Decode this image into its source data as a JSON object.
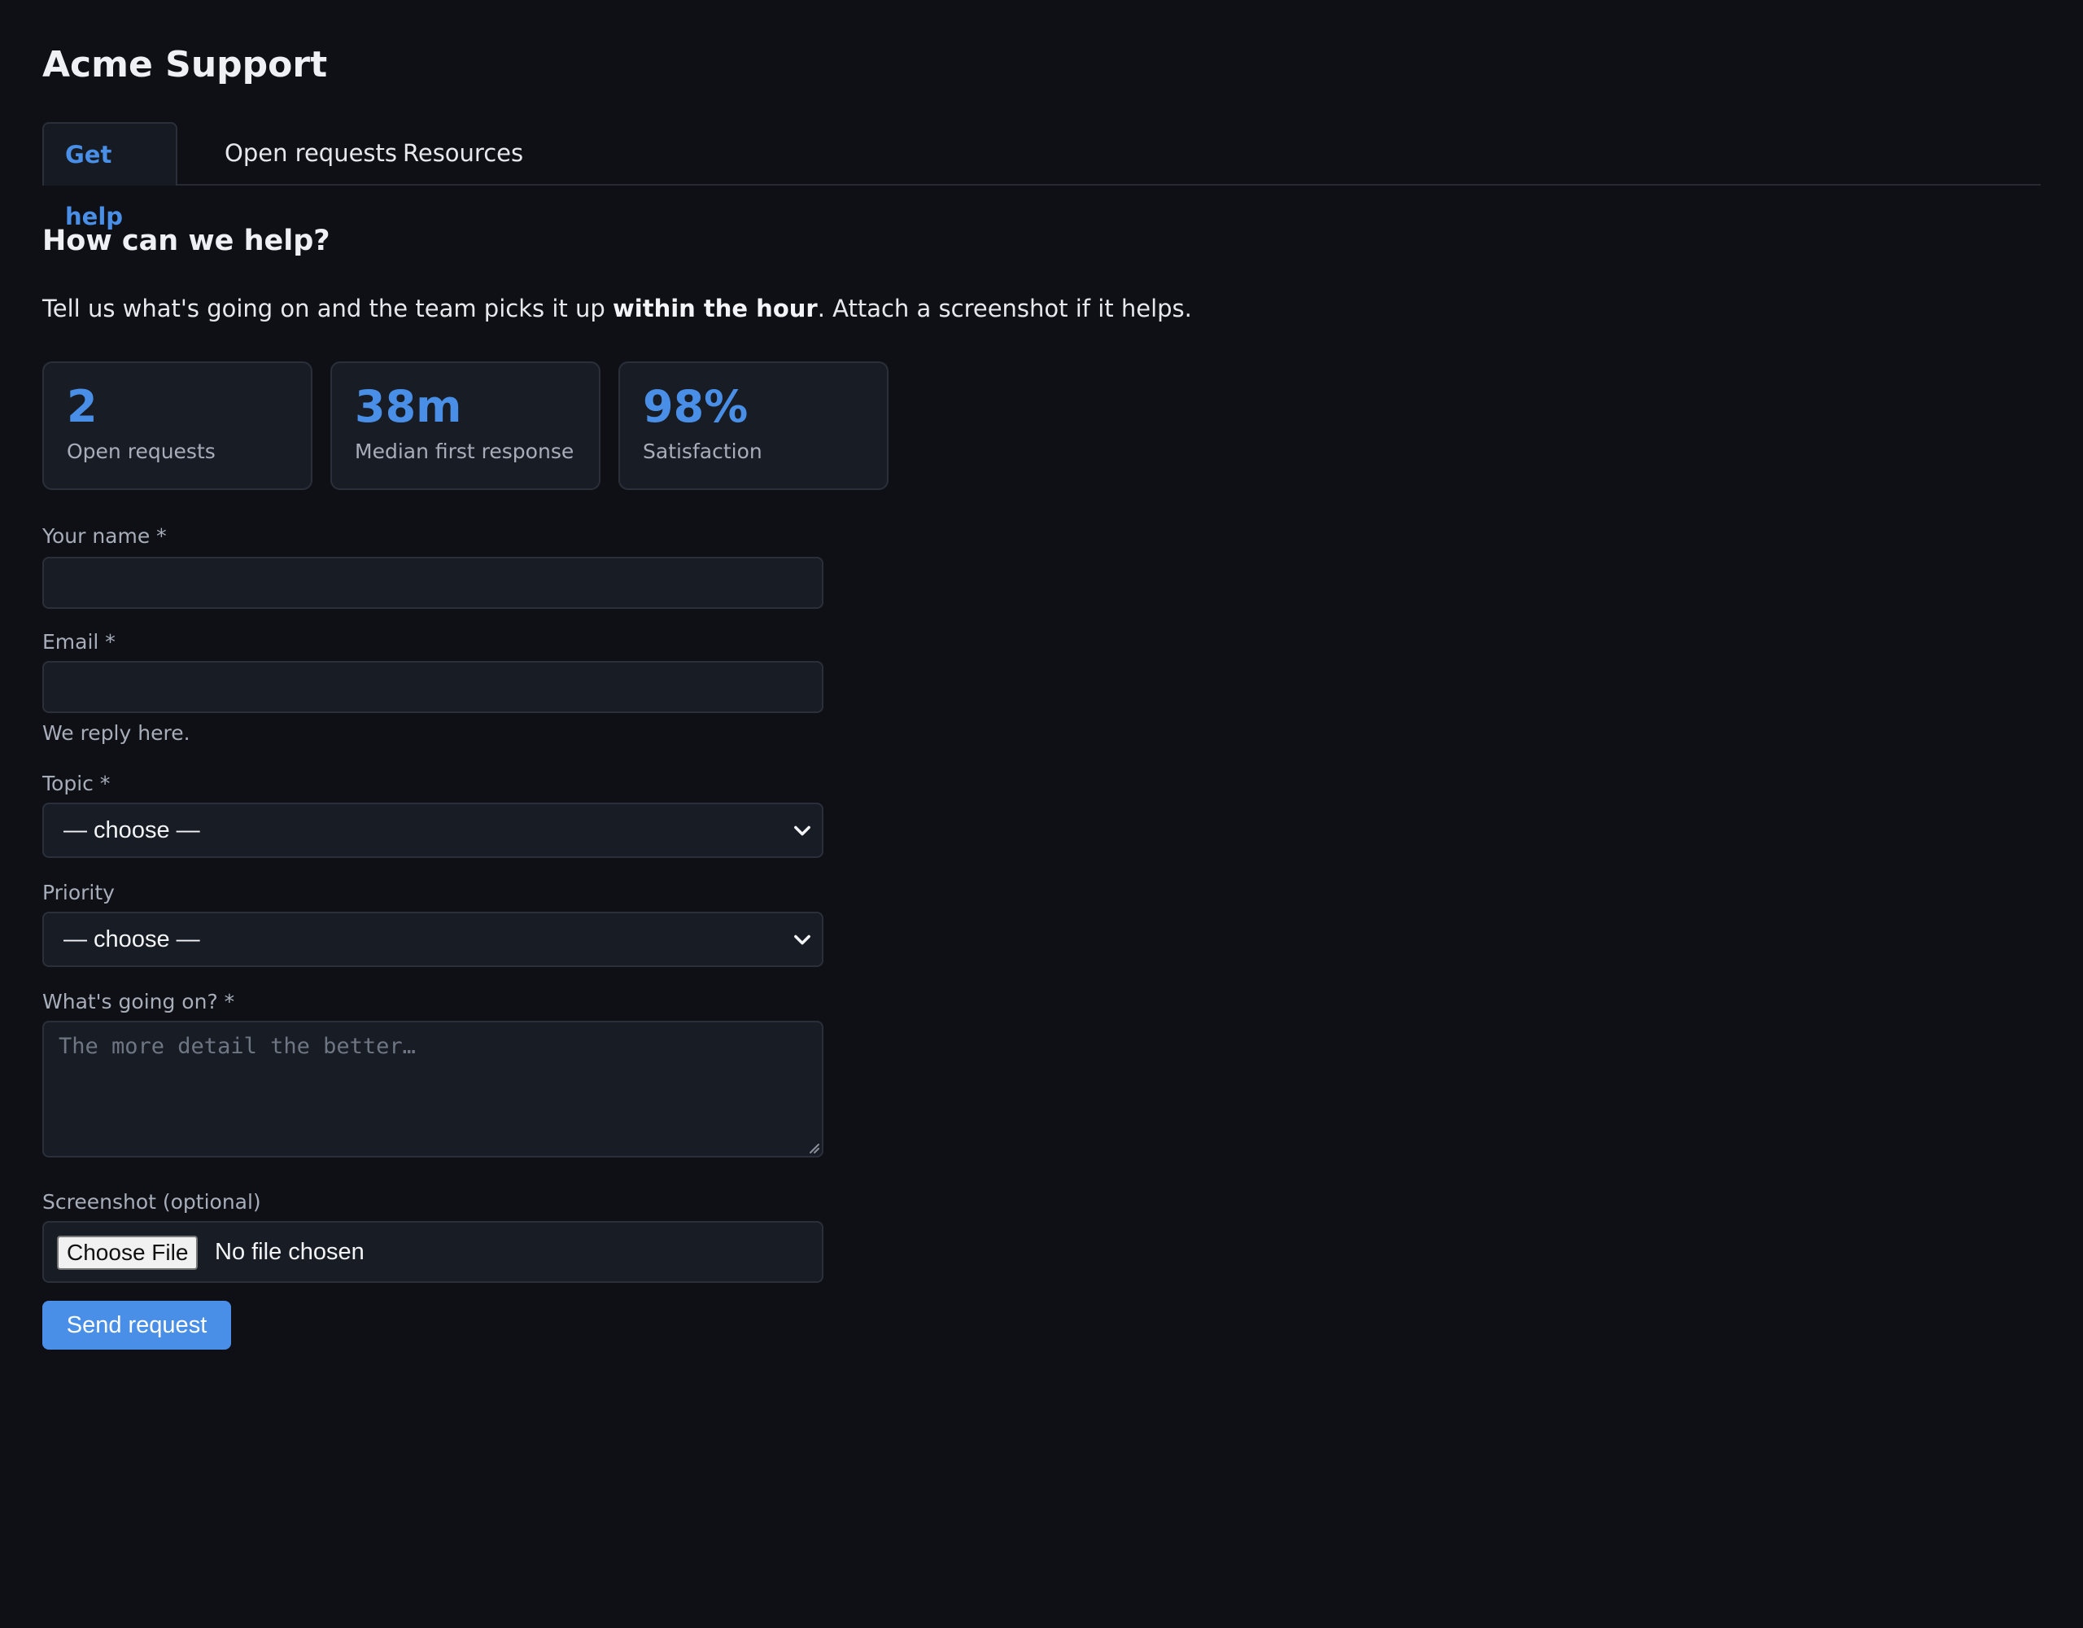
{
  "app": {
    "title": "Acme Support"
  },
  "tabs": [
    {
      "label": "Get help",
      "active": true
    },
    {
      "label": "Open requests",
      "active": false
    },
    {
      "label": "Resources",
      "active": false
    }
  ],
  "main": {
    "heading": "How can we help?",
    "intro_before": "Tell us what's going on and the team picks it up ",
    "intro_bold": "within the hour",
    "intro_after": ". Attach a screenshot if it helps."
  },
  "stats": [
    {
      "value": "2",
      "label": "Open requests"
    },
    {
      "value": "38m",
      "label": "Median first response"
    },
    {
      "value": "98%",
      "label": "Satisfaction"
    }
  ],
  "form": {
    "name": {
      "label": "Your name *",
      "value": ""
    },
    "email": {
      "label": "Email *",
      "value": "",
      "hint": "We reply here."
    },
    "topic": {
      "label": "Topic *",
      "selected": "— choose —"
    },
    "priority": {
      "label": "Priority",
      "selected": "— choose —"
    },
    "details": {
      "label": "What's going on? *",
      "placeholder": "The more detail the better…",
      "value": ""
    },
    "screenshot": {
      "label": "Screenshot (optional)",
      "button_label": "Choose File",
      "status": "No file chosen"
    },
    "submit_label": "Send request"
  },
  "colors": {
    "background": "#0e1015",
    "surface": "#181c24",
    "border": "#2a2f3a",
    "accent": "#4a8fe7",
    "muted_text": "#a7adb9"
  },
  "icons": {
    "select_arrow": "chevron-down-icon",
    "textarea_resize": "resize-handle-icon"
  }
}
